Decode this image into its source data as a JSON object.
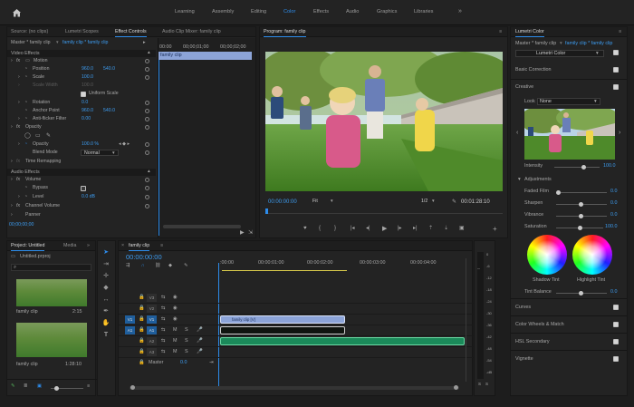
{
  "workspace": {
    "tabs": [
      "Learning",
      "Assembly",
      "Editing",
      "Color",
      "Effects",
      "Audio",
      "Graphics",
      "Libraries"
    ],
    "active": "Color",
    "more": "»"
  },
  "source_panel": {
    "tabs": [
      "Source: (no clips)",
      "Lumetri Scopes",
      "Effect Controls",
      "Audio Clip Mixer: family clip"
    ],
    "master": "Master * family clip",
    "clip": "family clip * family clip",
    "ruler": [
      "00:00",
      "00;00;01;00",
      "00;00;02;00"
    ],
    "clip_bar": "family clip",
    "video_effects": "Video Effects",
    "motion": "Motion",
    "position_label": "Position",
    "position_x": "960.0",
    "position_y": "540.0",
    "scale_label": "Scale",
    "scale_value": "100.0",
    "scale_width_label": "Scale Width",
    "scale_width_value": "100.0",
    "uniform_scale": "Uniform Scale",
    "rotation_label": "Rotation",
    "rotation_value": "0.0",
    "anchor_label": "Anchor Point",
    "anchor_x": "960.0",
    "anchor_y": "540.0",
    "antiflicker_label": "Anti-flicker Filter",
    "antiflicker_value": "0.00",
    "opacity_section": "Opacity",
    "opacity_label": "Opacity",
    "opacity_value": "100.0 %",
    "blend_label": "Blend Mode",
    "blend_value": "Normal",
    "time_remap": "Time Remapping",
    "audio_effects": "Audio Effects",
    "volume": "Volume",
    "bypass_label": "Bypass",
    "level_label": "Level",
    "level_value": "0.0 dB",
    "channel_volume": "Channel Volume",
    "panner": "Panner",
    "timecode": "00;00;00;00"
  },
  "program": {
    "title": "Program: family clip",
    "timecode": "00:00:00:00",
    "fit": "Fit",
    "resolution": "1/2",
    "duration": "00:01:28:10"
  },
  "project": {
    "tabs": [
      "Project: Untitled",
      "Media"
    ],
    "file": "Untitled.prproj",
    "items": [
      {
        "name": "family clip",
        "duration": "2:15"
      },
      {
        "name": "family clip",
        "duration": "1:28:10"
      }
    ]
  },
  "timeline": {
    "tab": "family clip",
    "timecode": "00:00:00:00",
    "ruler": [
      ":00:00",
      "00:00:01:00",
      "00:00:02:00",
      "00:00:03:00",
      "00:00:04:00"
    ],
    "tracks": [
      {
        "id": "V3",
        "src": ""
      },
      {
        "id": "V2",
        "src": ""
      },
      {
        "id": "V1",
        "src": "V1"
      },
      {
        "id": "A1",
        "src": "A1"
      },
      {
        "id": "A2",
        "src": ""
      },
      {
        "id": "A3",
        "src": ""
      }
    ],
    "video_clip": "family clip [V]",
    "master_label": "Master",
    "master_value": "0.0",
    "meter_labels": [
      "0",
      "-6",
      "-12",
      "-18",
      "-24",
      "-30",
      "-36",
      "-42",
      "-48",
      "-54",
      "-dB"
    ],
    "meter_solo": [
      "S",
      "S"
    ]
  },
  "lumetri": {
    "title": "Lumetri Color",
    "master": "Master * family clip",
    "clip": "family clip * family clip",
    "effect": "Lumetri Color",
    "basic_correction": "Basic Correction",
    "creative": "Creative",
    "look_label": "Look",
    "look_value": "None",
    "intensity_label": "Intensity",
    "intensity_value": "100.0",
    "adjustments": "Adjustments",
    "faded_label": "Faded Film",
    "faded_value": "0.0",
    "sharpen_label": "Sharpen",
    "sharpen_value": "0.0",
    "vibrance_label": "Vibrance",
    "vibrance_value": "0.0",
    "saturation_label": "Saturation",
    "saturation_value": "100.0",
    "shadow_tint": "Shadow Tint",
    "highlight_tint": "Highlight Tint",
    "tint_balance_label": "Tint Balance",
    "tint_balance_value": "0.0",
    "curves": "Curves",
    "wheels": "Color Wheels & Match",
    "hsl": "HSL Secondary",
    "vignette": "Vignette"
  },
  "colors": {
    "accent": "#2d8ceb",
    "panel": "#232323",
    "video_clip": "#8ca4d8",
    "audio_clip": "#1b8a5a"
  }
}
